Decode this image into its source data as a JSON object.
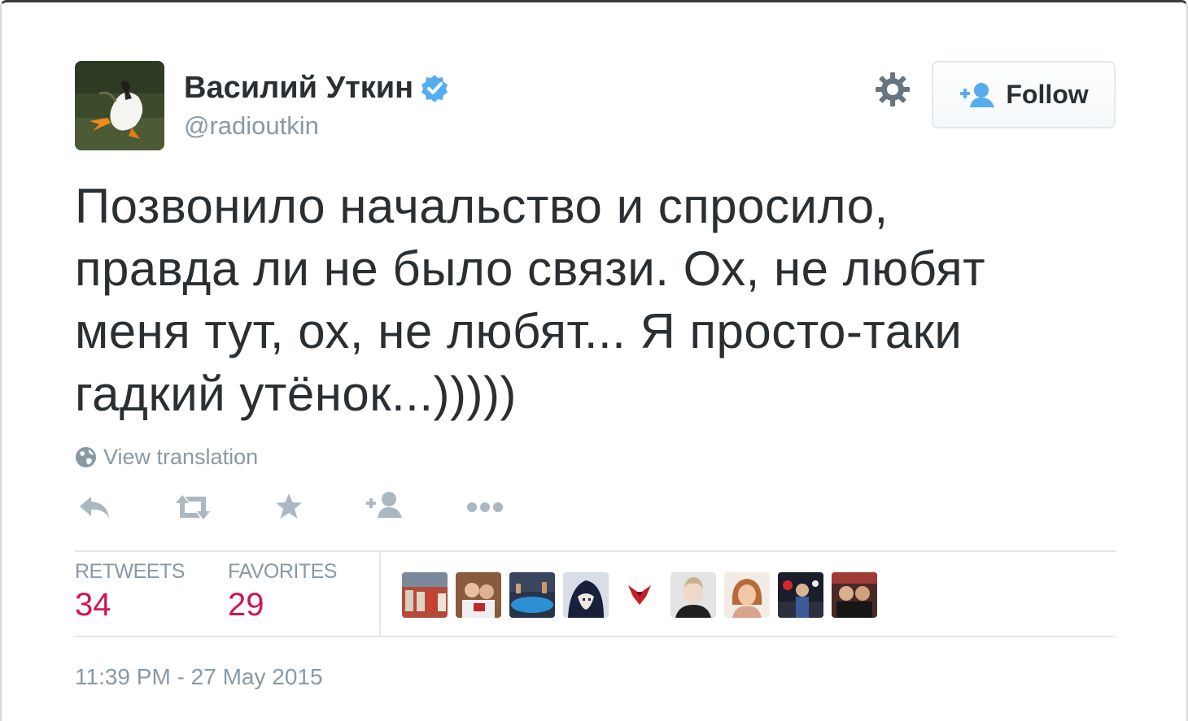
{
  "author": {
    "name": "Василий Уткин",
    "screen_name": "@radioutkin",
    "verified": true,
    "avatar_icon": "duck-avatar"
  },
  "follow_button": {
    "label": "Follow",
    "icon": "add-user-icon"
  },
  "settings_icon": "gear-icon",
  "tweet": {
    "text": "Позвонило начальство и спросило,\nправда ли не было связи. Ох, не любят\nменя тут, ох, не любят... Я просто-таки\nгадкий утёнок...)))))"
  },
  "translation": {
    "label": "View translation",
    "icon": "globe-icon"
  },
  "actions": [
    {
      "icon": "reply-icon"
    },
    {
      "icon": "retweet-icon"
    },
    {
      "icon": "favorite-star-icon"
    },
    {
      "icon": "follow-user-icon"
    },
    {
      "icon": "more-dots-icon"
    }
  ],
  "stats": {
    "retweets_label": "RETWEETS",
    "retweets_count": "34",
    "favorites_label": "FAVORITES",
    "favorites_count": "29"
  },
  "favoriters_count_shown": 9,
  "timestamp": "11:39 PM - 27 May 2015",
  "colors": {
    "text": "#292f33",
    "muted": "#8899a6",
    "count": "#d0145a",
    "verified": "#55acee",
    "border": "#e1e8ed"
  }
}
